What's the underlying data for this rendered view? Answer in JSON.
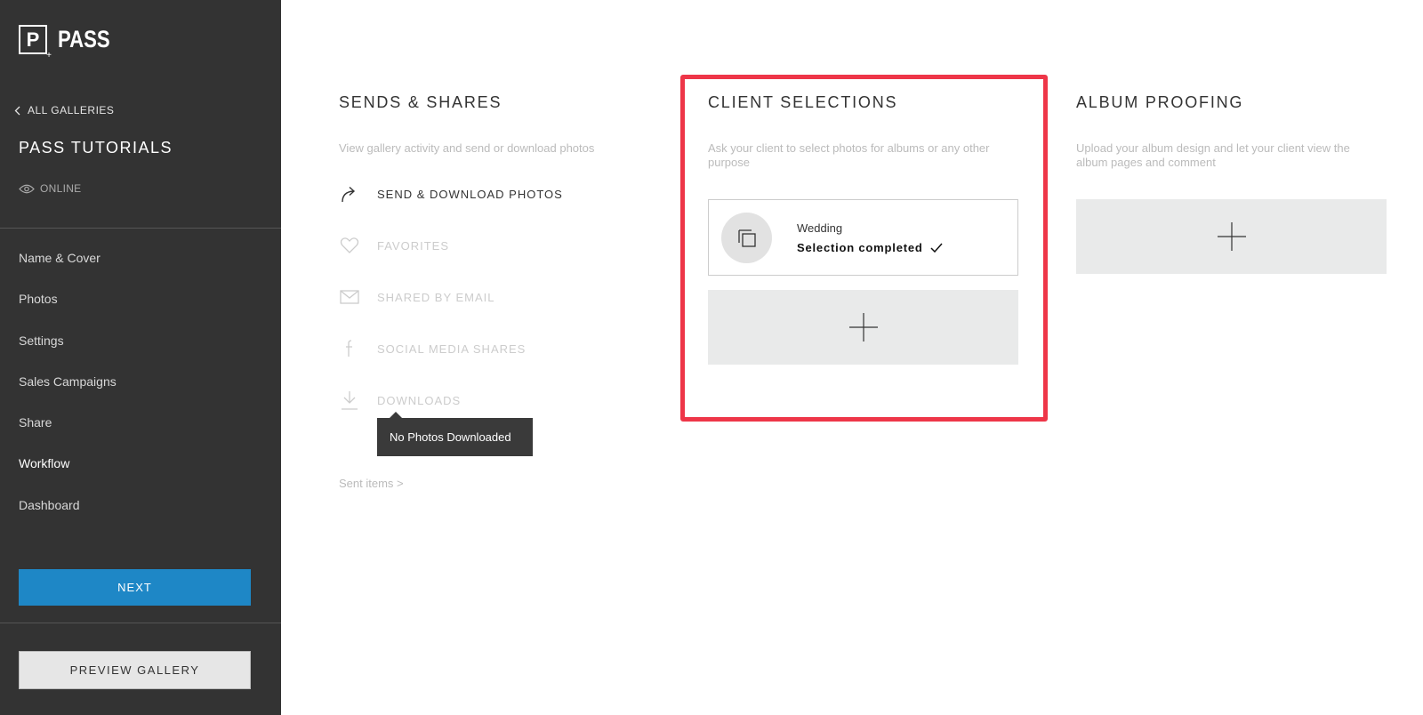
{
  "app": {
    "logo_letter": "P",
    "logo_text": "PASS"
  },
  "sidebar": {
    "back_label": "ALL GALLERIES",
    "gallery_title": "PASS TUTORIALS",
    "status_label": "ONLINE",
    "items": [
      {
        "label": "Name & Cover"
      },
      {
        "label": "Photos"
      },
      {
        "label": "Settings"
      },
      {
        "label": "Sales Campaigns"
      },
      {
        "label": "Share"
      },
      {
        "label": "Workflow"
      },
      {
        "label": "Dashboard"
      }
    ],
    "active_item": "Workflow",
    "next_label": "NEXT",
    "preview_label": "PREVIEW GALLERY"
  },
  "sends_shares": {
    "title": "SENDS & SHARES",
    "description": "View gallery activity and send or download photos",
    "actions": [
      {
        "label": "SEND & DOWNLOAD PHOTOS",
        "icon": "share-arrow-icon",
        "enabled": true
      },
      {
        "label": "FAVORITES",
        "icon": "heart-icon",
        "enabled": false
      },
      {
        "label": "SHARED BY EMAIL",
        "icon": "envelope-icon",
        "enabled": false
      },
      {
        "label": "SOCIAL MEDIA SHARES",
        "icon": "facebook-icon",
        "enabled": false
      },
      {
        "label": "DOWNLOADS",
        "icon": "download-icon",
        "enabled": false
      }
    ],
    "tooltip": "No Photos Downloaded",
    "sent_items_link": "Sent items >"
  },
  "client_selections": {
    "title": "CLIENT SELECTIONS",
    "description_line1": "Ask your client to select photos for albums or any other",
    "description_line2": "purpose",
    "selection": {
      "name": "Wedding",
      "status": "Selection completed"
    }
  },
  "album_proofing": {
    "title": "ALBUM PROOFING",
    "description_line1": "Upload your album design and let your client view the",
    "description_line2": "album pages and comment"
  },
  "colors": {
    "sidebar_bg": "#333333",
    "accent_blue": "#1e87c6",
    "highlight_red": "#ee3648",
    "add_box_bg": "#e9eaea"
  }
}
